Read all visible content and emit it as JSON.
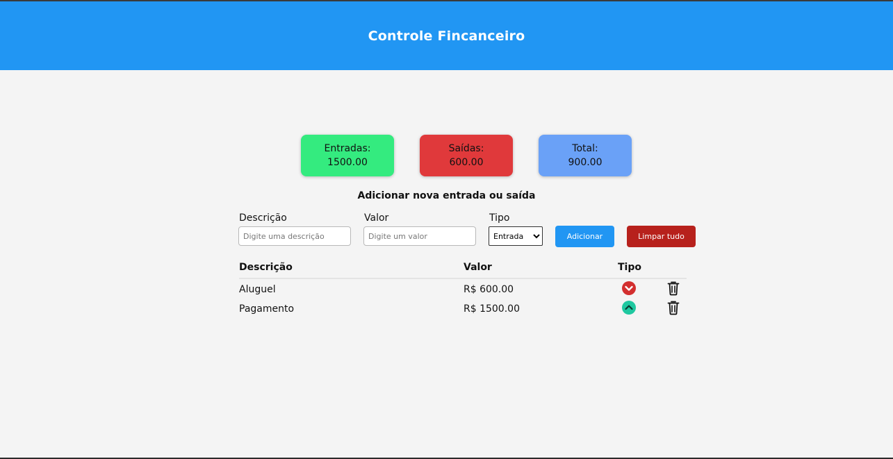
{
  "header": {
    "title": "Controle Fincanceiro"
  },
  "summary": {
    "income_label": "Entradas:",
    "income_value": "1500.00",
    "expense_label": "Saídas:",
    "expense_value": "600.00",
    "total_label": "Total:",
    "total_value": "900.00"
  },
  "form": {
    "title": "Adicionar nova entrada ou saída",
    "desc_label": "Descrição",
    "desc_placeholder": "Digite uma descrição",
    "value_label": "Valor",
    "value_placeholder": "Digite um valor",
    "type_label": "Tipo",
    "type_selected": "Entrada",
    "add_button": "Adicionar",
    "clear_button": "Limpar tudo"
  },
  "table": {
    "headers": {
      "desc": "Descrição",
      "value": "Valor",
      "type": "Tipo"
    },
    "rows": [
      {
        "desc": "Aluguel",
        "value": "R$ 600.00",
        "type_icon": "chevron-down-circle-icon"
      },
      {
        "desc": "Pagamento",
        "value": "R$ 1500.00",
        "type_icon": "chevron-up-circle-icon"
      }
    ]
  },
  "colors": {
    "header": "#2196f3",
    "income": "#34eb7f",
    "expense": "#e0393b",
    "total": "#6aa1f7",
    "add_button": "#2196f3",
    "clear_button": "#b7211c",
    "down_icon": "#d32f2f",
    "up_icon": "#1fc8a0"
  }
}
